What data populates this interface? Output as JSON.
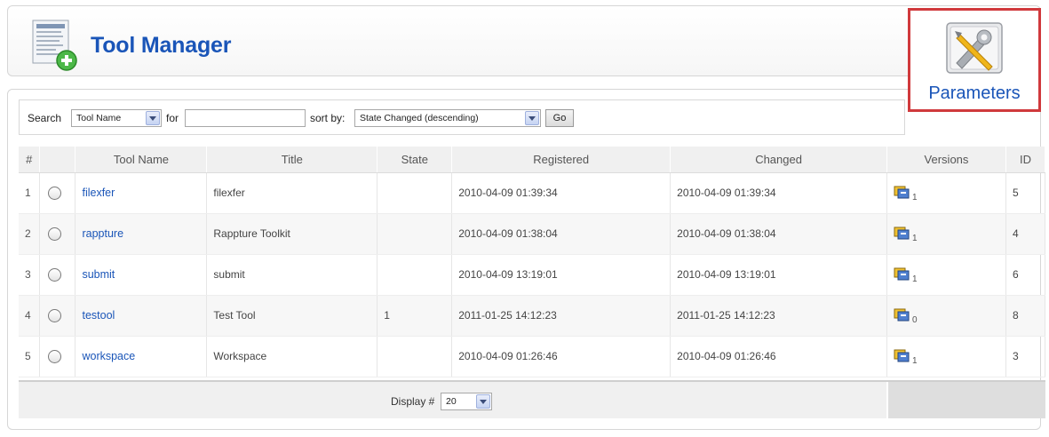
{
  "header": {
    "title": "Tool Manager"
  },
  "toolbar": {
    "parameters_label": "Parameters"
  },
  "filter": {
    "search_label": "Search",
    "search_field_value": "Tool Name",
    "for_label": "for",
    "search_text_value": "",
    "sort_label": "sort by:",
    "sort_value": "State Changed (descending)",
    "go_label": "Go"
  },
  "table": {
    "columns": [
      "#",
      "",
      "Tool Name",
      "Title",
      "State",
      "Registered",
      "Changed",
      "Versions",
      "ID"
    ],
    "rows": [
      {
        "num": "1",
        "name": "filexfer",
        "title": "filexfer",
        "state": "",
        "registered": "2010-04-09 01:39:34",
        "changed": "2010-04-09 01:39:34",
        "versions": "1",
        "id": "5"
      },
      {
        "num": "2",
        "name": "rappture",
        "title": "Rappture Toolkit",
        "state": "",
        "registered": "2010-04-09 01:38:04",
        "changed": "2010-04-09 01:38:04",
        "versions": "1",
        "id": "4"
      },
      {
        "num": "3",
        "name": "submit",
        "title": "submit",
        "state": "",
        "registered": "2010-04-09 13:19:01",
        "changed": "2010-04-09 13:19:01",
        "versions": "1",
        "id": "6"
      },
      {
        "num": "4",
        "name": "testool",
        "title": "Test Tool",
        "state": "1",
        "registered": "2011-01-25 14:12:23",
        "changed": "2011-01-25 14:12:23",
        "versions": "0",
        "id": "8"
      },
      {
        "num": "5",
        "name": "workspace",
        "title": "Workspace",
        "state": "",
        "registered": "2010-04-09 01:26:46",
        "changed": "2010-04-09 01:26:46",
        "versions": "1",
        "id": "3"
      }
    ]
  },
  "footer": {
    "display_label": "Display #",
    "display_value": "20"
  },
  "colors": {
    "link": "#1a55b8",
    "highlight_border": "#d0393c"
  },
  "icons": {
    "header": "tool-manager-add-icon",
    "toolbar": "wrench-screwdriver-icon",
    "versions": "versions-icon"
  }
}
